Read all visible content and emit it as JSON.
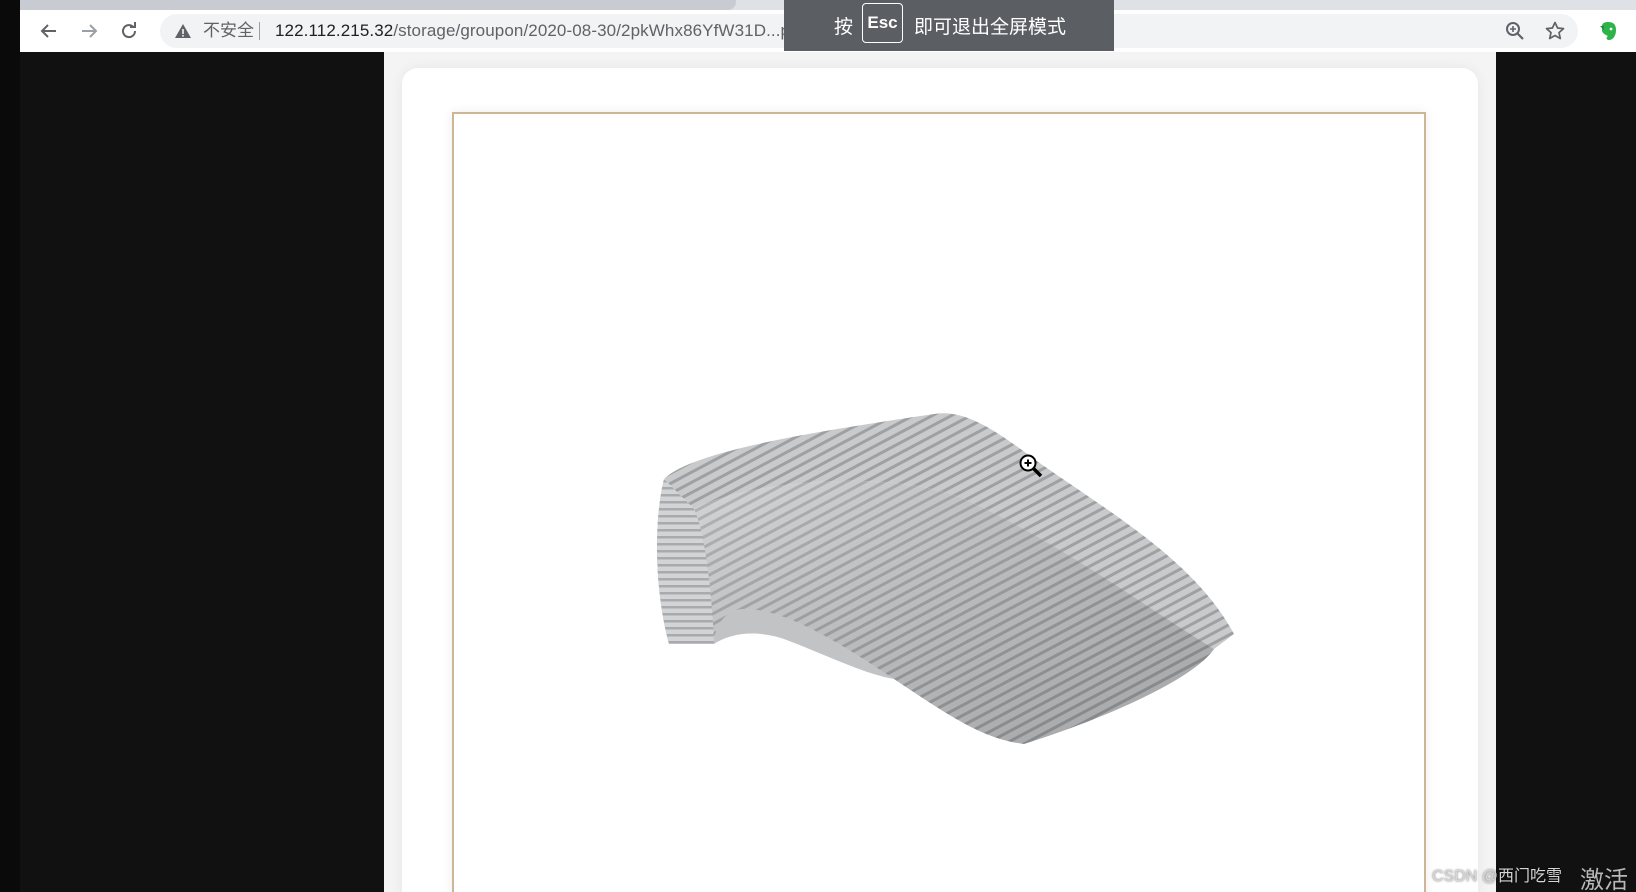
{
  "browser": {
    "security_label": "不安全",
    "url_host": "122.112.215.32",
    "url_path": "/storage/groupon/2020-08-30/2pkWhx86YfW31D...png",
    "icons": {
      "back": "arrow-left-icon",
      "forward": "arrow-right-icon",
      "reload": "reload-icon",
      "warning": "warning-triangle-icon",
      "zoom": "zoom-in-icon",
      "bookmark": "star-icon",
      "extension": "evernote-elephant-icon"
    }
  },
  "fullscreen_toast": {
    "press": "按",
    "key": "Esc",
    "message": "即可退出全屏模式"
  },
  "page": {
    "image_subject": "gray striped memory foam nap pillow",
    "frame_color": "#cdb596",
    "cursor": "zoom-in-cursor-icon"
  },
  "overlay": {
    "watermark": "CSDN @西门吃雪",
    "activation_text": "激活"
  }
}
